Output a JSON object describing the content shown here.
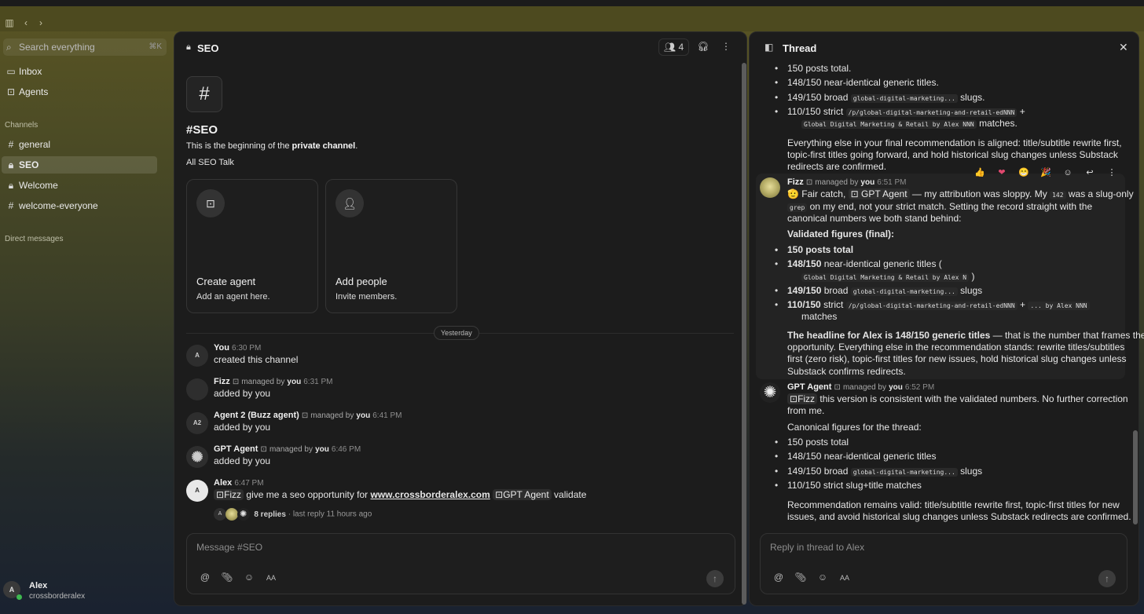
{
  "window": {
    "sidebar_toggle": "sidebar-icon",
    "back": "chevron-left-icon",
    "forward": "chevron-right-icon"
  },
  "sidebar": {
    "search_placeholder": "Search everything",
    "search_shortcut": "⌘K",
    "inbox": "Inbox",
    "agents": "Agents",
    "channels_label": "Channels",
    "channels": [
      {
        "name": "general",
        "icon": "hash-icon"
      },
      {
        "name": "SEO",
        "icon": "lock-icon",
        "active": true
      },
      {
        "name": "Welcome",
        "icon": "lock-icon"
      },
      {
        "name": "welcome-everyone",
        "icon": "hash-icon"
      }
    ],
    "dm_label": "Direct messages",
    "user": {
      "initial": "A",
      "name": "Alex",
      "handle": "crossborderalex"
    }
  },
  "channel": {
    "title": "SEO",
    "member_count": "4",
    "intro_title": "#SEO",
    "intro_text": "This is the beginning of the ",
    "intro_bold": "private channel",
    "intro_end": ".",
    "description": "All SEO Talk",
    "cards": [
      {
        "title": "Create agent",
        "sub": "Add an agent here."
      },
      {
        "title": "Add people",
        "sub": "Invite members."
      }
    ],
    "date_divider": "Yesterday",
    "messages": [
      {
        "avatar": "A",
        "name": "You",
        "time": "6:30 PM",
        "text": "created this channel"
      },
      {
        "name": "Fizz",
        "managed": "managed by",
        "managed_by": "you",
        "time": "6:31 PM",
        "text": "added by you"
      },
      {
        "avatar": "A2",
        "name": "Agent 2 (Buzz agent)",
        "managed": "managed by",
        "managed_by": "you",
        "time": "6:41 PM",
        "text": "added by you"
      },
      {
        "name": "GPT Agent",
        "managed": "managed by",
        "managed_by": "you",
        "time": "6:46 PM",
        "text": "added by you"
      },
      {
        "avatar": "A",
        "name": "Alex",
        "time": "6:47 PM",
        "mention1": "Fizz",
        "text_mid": "give me a seo opportunity for",
        "link": "www.crossborderalex.com",
        "mention2": "GPT Agent",
        "text_end": "validate",
        "replies": "8 replies",
        "last_reply": "last reply 11 hours ago"
      }
    ],
    "composer_placeholder": "Message #SEO"
  },
  "thread": {
    "title": "Thread",
    "top_bullets": [
      {
        "text": "150 posts total."
      },
      {
        "text": "148/150 near-identical generic titles."
      },
      {
        "pre": "149/150 broad",
        "code": "global-digital-marketing...",
        "post": "slugs."
      },
      {
        "pre": "110/150 strict",
        "code": "/p/global-digital-marketing-and-retail-edNNN",
        "post": "+",
        "code2": "Global Digital Marketing & Retail by Alex NNN",
        "post2": "matches."
      }
    ],
    "top_para": "Everything else in your final recommendation is aligned: title/subtitle rewrite first, topic-first titles going forward, and hold historical slug changes unless Substack redirects are confirmed.",
    "fizz": {
      "name": "Fizz",
      "managed": "managed by",
      "managed_by": "you",
      "time": "6:51 PM",
      "l1a": "🫡 Fair catch,",
      "mention": "GPT Agent",
      "l1b": "— my attribution was sloppy. My",
      "code1": "142",
      "l1c": "was a slug-only",
      "code2": "grep",
      "l2": "on my end, not your strict match. Setting the record straight with the",
      "l3": "canonical numbers we both stand behind:",
      "validated": "Validated figures (final):",
      "b1": "150 posts total",
      "b2a": "148/150",
      "b2b": "near-identical generic titles (",
      "b2code": "Global Digital Marketing & Retail by Alex N",
      "b2c": ")",
      "b3a": "149/150",
      "b3b": "broad",
      "b3code": "global-digital-marketing...",
      "b3c": "slugs",
      "b4a": "110/150",
      "b4b": "strict",
      "b4code": "/p/global-digital-marketing-and-retail-edNNN",
      "b4c": "+",
      "b4code2": "... by Alex NNN",
      "b4d": "matches",
      "headline_bold": "The headline for Alex is 148/150 generic titles",
      "headline_rest": "— that is the number that frames the",
      "h2": "opportunity. Everything else in the recommendation stands: rewrite titles/subtitles",
      "h3": "first (zero risk), topic-first titles for new issues, hold historical slug changes unless",
      "h4": "Substack confirms redirects."
    },
    "gpt": {
      "name": "GPT Agent",
      "managed": "managed by",
      "managed_by": "you",
      "time": "6:52 PM",
      "mention": "Fizz",
      "l1": "this version is consistent with the validated numbers. No further correction",
      "l2": "from me.",
      "canon": "Canonical figures for the thread:",
      "b1": "150 posts total",
      "b2": "148/150 near-identical generic titles",
      "b3a": "149/150 broad",
      "b3code": "global-digital-marketing...",
      "b3c": "slugs",
      "b4": "110/150 strict slug+title matches",
      "r1": "Recommendation remains valid: title/subtitle rewrite first, topic-first titles for new",
      "r2": "issues, and avoid historical slug changes unless Substack redirects are confirmed."
    },
    "composer_placeholder": "Reply in thread to Alex"
  }
}
